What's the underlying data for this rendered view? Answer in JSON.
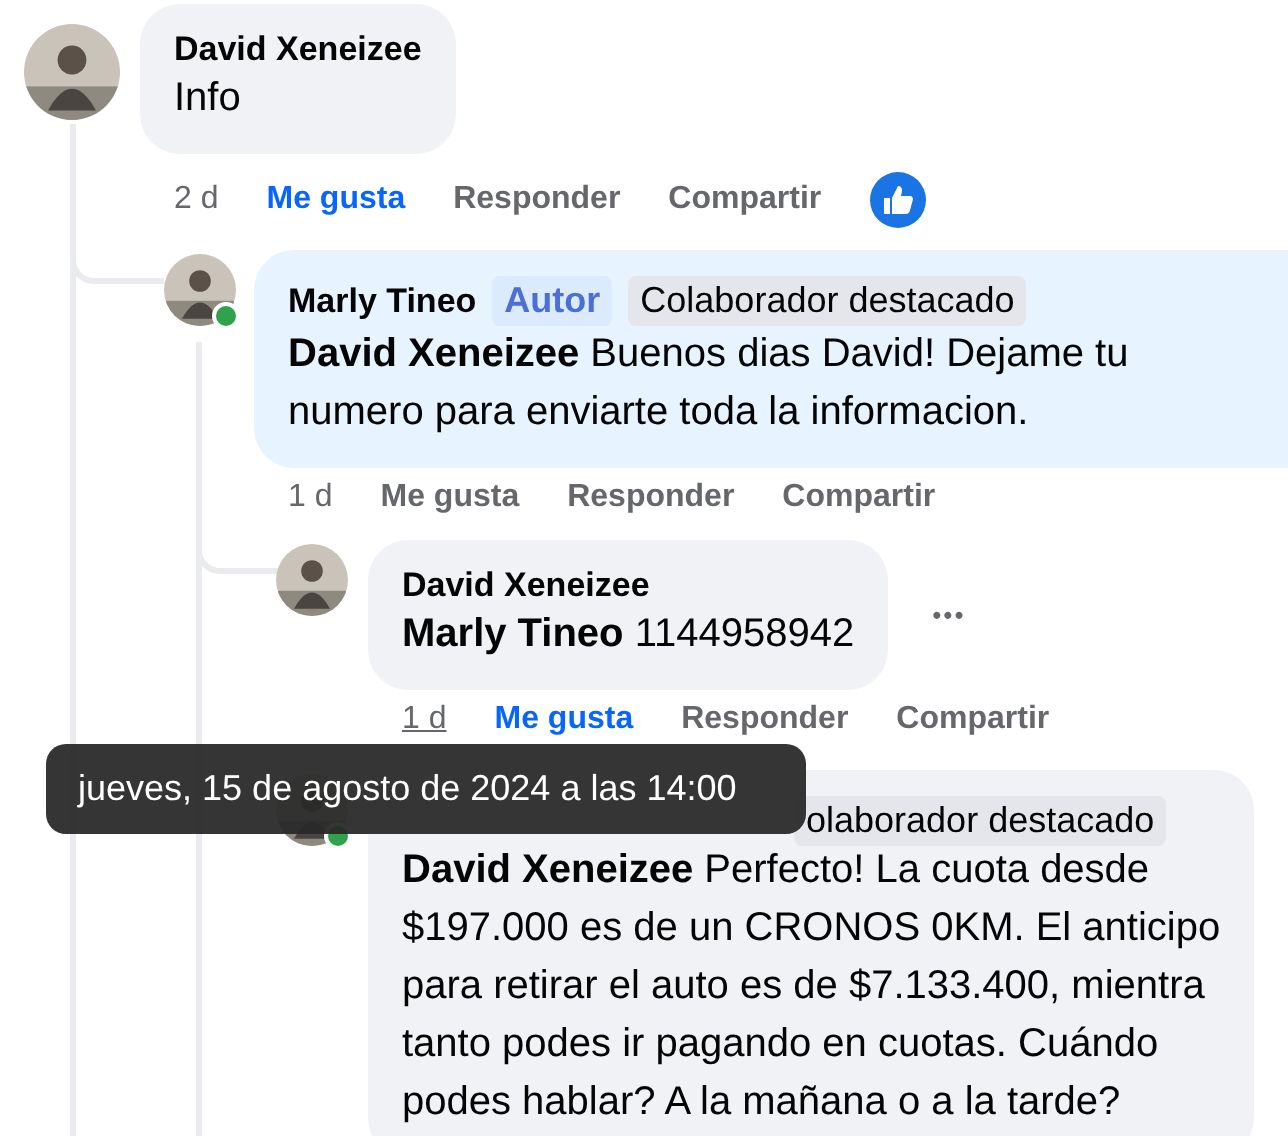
{
  "comments": [
    {
      "author": "David Xeneizee",
      "body": "Info",
      "time": "2 d",
      "liked": true,
      "reactions": [
        {
          "kind": "like"
        }
      ],
      "actions": [
        "Me gusta",
        "Responder",
        "Compartir"
      ],
      "children": [
        {
          "author": "Marly Tineo",
          "badges": [
            {
              "label": "Autor",
              "kind": "author"
            },
            {
              "label": "Colaborador destacado",
              "kind": "featured"
            }
          ],
          "body": "**David Xeneizee** Buenos dias David! Dejame tu\nnumero para enviarte toda la informacion.",
          "highlighted": true,
          "online": true,
          "time": "1 d",
          "liked": false,
          "actions": [
            "Me gusta",
            "Responder",
            "Compartir"
          ],
          "children": [
            {
              "author": "David Xeneizee",
              "body": "**Marly Tineo** 1144958942",
              "time": "1 d",
              "time_hovered": true,
              "liked": true,
              "more_menu": true,
              "more_label": "•••",
              "actions": [
                "Me gusta",
                "Responder",
                "Compartir"
              ]
            },
            {
              "badges": [
                {
                  "label": "olaborador destacado",
                  "kind": "featured"
                }
              ],
              "body": "**David Xeneizee** Perfecto! La cuota desde\n$197.000 es de un CRONOS 0KM. El anticipo\npara retirar el auto es de $7.133.400, mientra\ntanto podes ir pagando en cuotas. Cuándo\npodes hablar? A la mañana o a la tarde?",
              "online": true
            }
          ]
        }
      ]
    }
  ],
  "tooltip": {
    "text": "jueves, 15 de agosto de 2024 a las 14:00"
  }
}
